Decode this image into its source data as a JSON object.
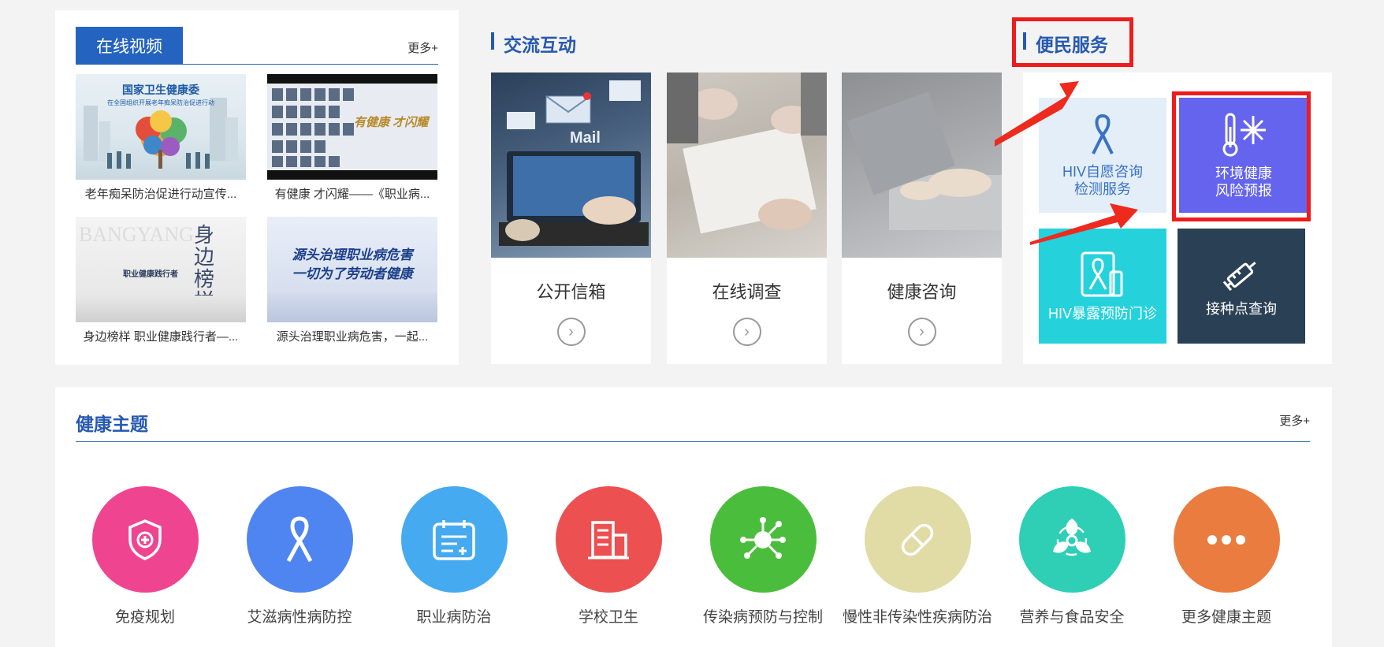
{
  "video": {
    "tab_label": "在线视频",
    "more": "更多+",
    "items": [
      {
        "caption": "老年痴呆防治促进行动宣传...",
        "thumb_title": "国家卫生健康委",
        "thumb_sub": "在全国组织开展老年痴呆防治促进行动"
      },
      {
        "caption": "有健康 才闪耀——《职业病...",
        "thumb_title": "有健康 才闪耀"
      },
      {
        "caption": "身边榜样 职业健康践行者—...",
        "thumb_title": "身边榜样",
        "thumb_sub": "职业健康践行者",
        "thumb_bg": "BANGYANG"
      },
      {
        "caption": "源头治理职业病危害，一起...",
        "thumb_title": "源头治理职业病危害",
        "thumb_sub": "一切为了劳动者健康"
      }
    ]
  },
  "interaction": {
    "title": "交流互动",
    "cards": [
      {
        "label": "公开信箱",
        "img_text": "Mail"
      },
      {
        "label": "在线调查"
      },
      {
        "label": "健康咨询"
      }
    ]
  },
  "service": {
    "title": "便民服务",
    "tiles": [
      {
        "line1": "HIV自愿咨询",
        "line2": "检测服务",
        "icon": "ribbon-icon",
        "bg": "#e3eef9",
        "color": "#3a72c2"
      },
      {
        "line1": "环境健康",
        "line2": "风险预报",
        "icon": "thermometer-snowflake-icon",
        "bg": "#6464ee",
        "color": "#ffffff"
      },
      {
        "line1": "HIV暴露预防门诊",
        "line2": "",
        "icon": "ribbon-box-icon",
        "bg": "#25d2dc",
        "color": "#ffffff"
      },
      {
        "line1": "接种点查询",
        "line2": "",
        "icon": "syringe-icon",
        "bg": "#2a4055",
        "color": "#ffffff"
      }
    ]
  },
  "topics": {
    "title": "健康主题",
    "more": "更多+",
    "items": [
      {
        "label": "免疫规划",
        "color": "#ef4590",
        "icon": "shield-plus-icon"
      },
      {
        "label": "艾滋病性病防控",
        "color": "#4f85f0",
        "icon": "ribbon-icon"
      },
      {
        "label": "职业病防治",
        "color": "#45aaf0",
        "icon": "calendar-icon"
      },
      {
        "label": "学校卫生",
        "color": "#ec5050",
        "icon": "building-icon"
      },
      {
        "label": "传染病预防与控制",
        "color": "#4bbd3c",
        "icon": "virus-icon"
      },
      {
        "label": "慢性非传染性疾病防治",
        "color": "#e1dba6",
        "icon": "pill-icon"
      },
      {
        "label": "营养与食品安全",
        "color": "#2ecfb5",
        "icon": "biohazard-icon"
      },
      {
        "label": "更多健康主题",
        "color": "#ea7c3f",
        "icon": "more-dots-icon"
      }
    ]
  },
  "colors": {
    "accent": "#2464c0",
    "annotation_red": "#ee1c1c"
  }
}
